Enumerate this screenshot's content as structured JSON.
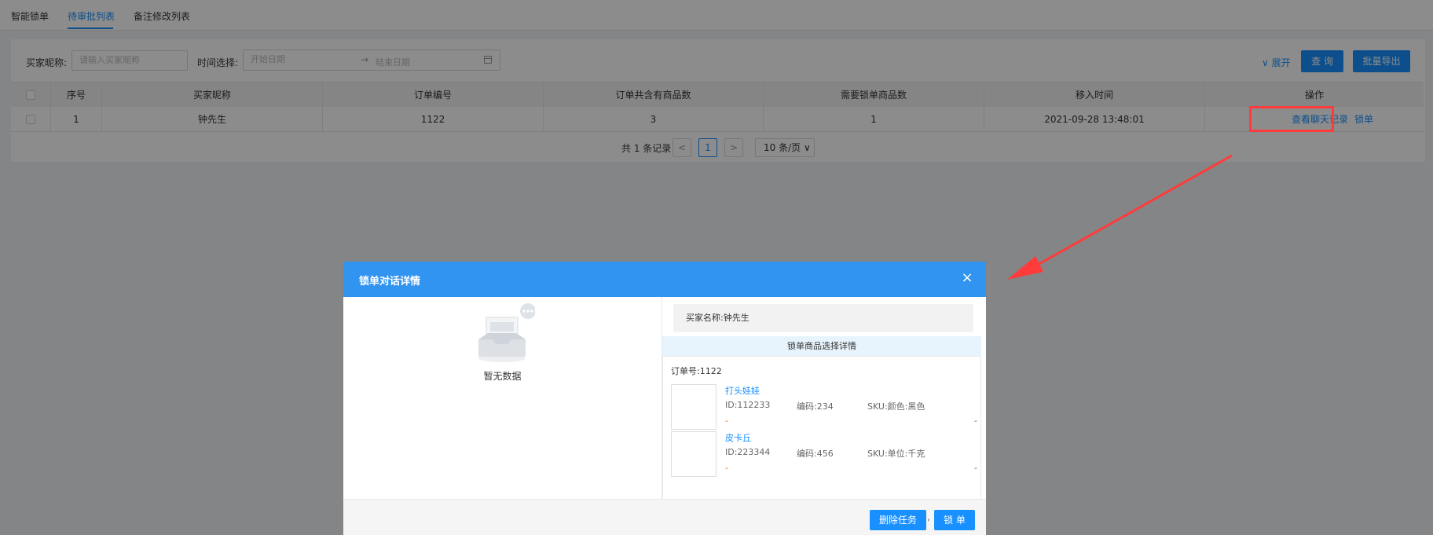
{
  "tabs": [
    "智能锁单",
    "待审批列表",
    "备注修改列表"
  ],
  "filters": {
    "buyer_label": "买家昵称:",
    "buyer_placeholder": "请输入买家昵称",
    "time_label": "时间选择:",
    "start_placeholder": "开始日期",
    "end_placeholder": "结束日期",
    "range_separator": "→",
    "expand_label": "∨ 展开",
    "query_label": "查 询",
    "export_label": "批量导出"
  },
  "table": {
    "headers": [
      "序号",
      "买家昵称",
      "订单编号",
      "订单共含有商品数",
      "需要锁单商品数",
      "移入时间",
      "操作"
    ],
    "rows": [
      [
        "1",
        "钟先生",
        "1122",
        "3",
        "1",
        "2021-09-28 13:48:01"
      ]
    ],
    "actions": [
      "查看聊天记录",
      "锁单"
    ]
  },
  "pagination": {
    "total_text": "共 1 条记录",
    "prev": "<",
    "current": "1",
    "next": ">",
    "page_size": "10 条/页 ∨"
  },
  "modal": {
    "title": "锁单对话详情",
    "close_icon": "×",
    "empty_text": "暂无数据",
    "buyer_label": "买家名称:",
    "buyer_name": "钟先生",
    "detail_title": "锁单商品选择详情",
    "order_label": "订单号:",
    "order_no": "1122",
    "products": [
      {
        "name": "打头娃娃",
        "id_label": "ID:",
        "id": "112233",
        "code_label": "编码:",
        "code": "234",
        "sku_label": "SKU:",
        "sku": "颜色:黑色",
        "price": "-",
        "tail": "-"
      },
      {
        "name": "皮卡丘",
        "id_label": "ID:",
        "id": "223344",
        "code_label": "编码:",
        "code": "456",
        "sku_label": "SKU:",
        "sku": "单位:千克",
        "price": "-",
        "tail": "-"
      }
    ],
    "delete_button": "删除任务",
    "separator": ",",
    "lock_button": "锁 单"
  },
  "colors": {
    "primary": "#1890ff",
    "modal_header": "#3094f0",
    "highlight": "#ff3b3b",
    "price": "#ff6a00"
  }
}
